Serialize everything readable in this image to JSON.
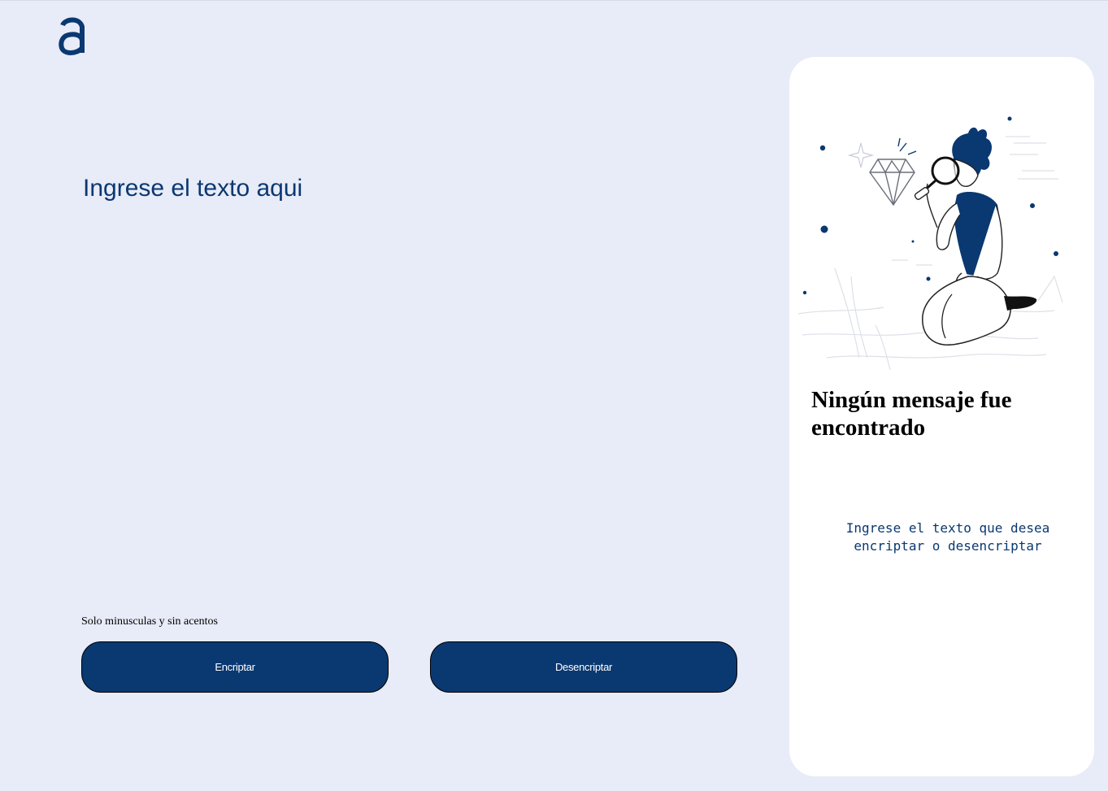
{
  "logo": {
    "icon": "alura-a-logo-icon",
    "color": "#0a3871"
  },
  "input": {
    "placeholder": "Ingrese el texto aqui",
    "value": ""
  },
  "hint": {
    "text": "Solo minusculas y sin acentos"
  },
  "buttons": {
    "encrypt_label": "Encriptar",
    "decrypt_label": "Desencriptar"
  },
  "output_panel": {
    "illustration": "person-with-magnifier-illustration",
    "title": "Ningún mensaje fue encontrado",
    "message": "Ingrese el texto que desea encriptar o desencriptar"
  },
  "colors": {
    "background": "#e8ebf8",
    "accent": "#0a3871",
    "panel": "#ffffff"
  }
}
